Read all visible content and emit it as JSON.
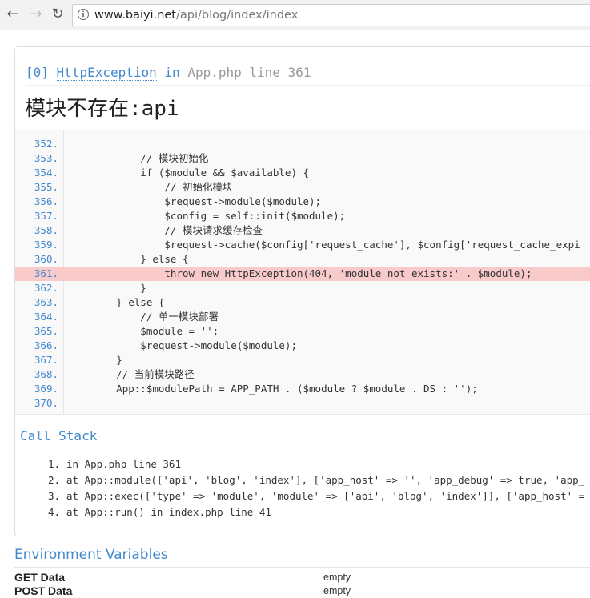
{
  "browser": {
    "url_host": "www.baiyi.net",
    "url_path": "/api/blog/index/index"
  },
  "exception": {
    "index": "[0]",
    "class": "HttpException",
    "in_word": "in",
    "file": "App.php",
    "line_word": "line",
    "line": "361",
    "message": "模块不存在:api"
  },
  "source": {
    "highlight_line": 361,
    "lines": [
      {
        "num": "352.",
        "code": ""
      },
      {
        "num": "353.",
        "code": "            // 模块初始化"
      },
      {
        "num": "354.",
        "code": "            if ($module && $available) {"
      },
      {
        "num": "355.",
        "code": "                // 初始化模块"
      },
      {
        "num": "356.",
        "code": "                $request->module($module);"
      },
      {
        "num": "357.",
        "code": "                $config = self::init($module);"
      },
      {
        "num": "358.",
        "code": "                // 模块请求缓存检查"
      },
      {
        "num": "359.",
        "code": "                $request->cache($config['request_cache'], $config['request_cache_expi"
      },
      {
        "num": "360.",
        "code": "            } else {"
      },
      {
        "num": "361.",
        "code": "                throw new HttpException(404, 'module not exists:' . $module);"
      },
      {
        "num": "362.",
        "code": "            }"
      },
      {
        "num": "363.",
        "code": "        } else {"
      },
      {
        "num": "364.",
        "code": "            // 单一模块部署"
      },
      {
        "num": "365.",
        "code": "            $module = '';"
      },
      {
        "num": "366.",
        "code": "            $request->module($module);"
      },
      {
        "num": "367.",
        "code": "        }"
      },
      {
        "num": "368.",
        "code": "        // 当前模块路径"
      },
      {
        "num": "369.",
        "code": "        App::$modulePath = APP_PATH . ($module ? $module . DS : '');"
      },
      {
        "num": "370.",
        "code": ""
      }
    ]
  },
  "call_stack": {
    "title": "Call Stack",
    "items": [
      {
        "idx": "1.",
        "text": "in App.php line 361"
      },
      {
        "idx": "2.",
        "text": "at App::module(['api', 'blog', 'index'], ['app_host' => '', 'app_debug' => true, 'app_"
      },
      {
        "idx": "3.",
        "text": "at App::exec(['type' => 'module', 'module' => ['api', 'blog', 'index']], ['app_host' ="
      },
      {
        "idx": "4.",
        "text": "at App::run() in index.php line 41"
      }
    ]
  },
  "environment": {
    "title": "Environment Variables",
    "rows": [
      {
        "key": "GET Data",
        "value": "empty"
      },
      {
        "key": "POST Data",
        "value": "empty"
      }
    ]
  }
}
